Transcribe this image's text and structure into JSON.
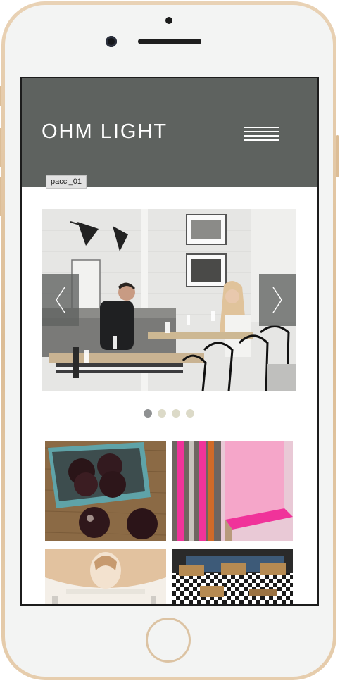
{
  "app": {
    "logo_text": "OHM LIGHT",
    "image_tag": "pacci_01"
  },
  "slider": {
    "active_index": 0,
    "dot_count": 4,
    "prev_icon": "chevron-left-icon",
    "next_icon": "chevron-right-icon"
  },
  "colors": {
    "header_bg": "#5e625f",
    "phone_frame": "#dcbd96",
    "dot_active": "#8f9192",
    "dot_inactive": "#dcdac8",
    "accent_pink": "#f0339a"
  },
  "gallery": {
    "tiles": [
      "eggplants-basket",
      "neon-pink-shelf",
      "pendant-lamp-portrait",
      "dining-room-checker-floor"
    ]
  }
}
